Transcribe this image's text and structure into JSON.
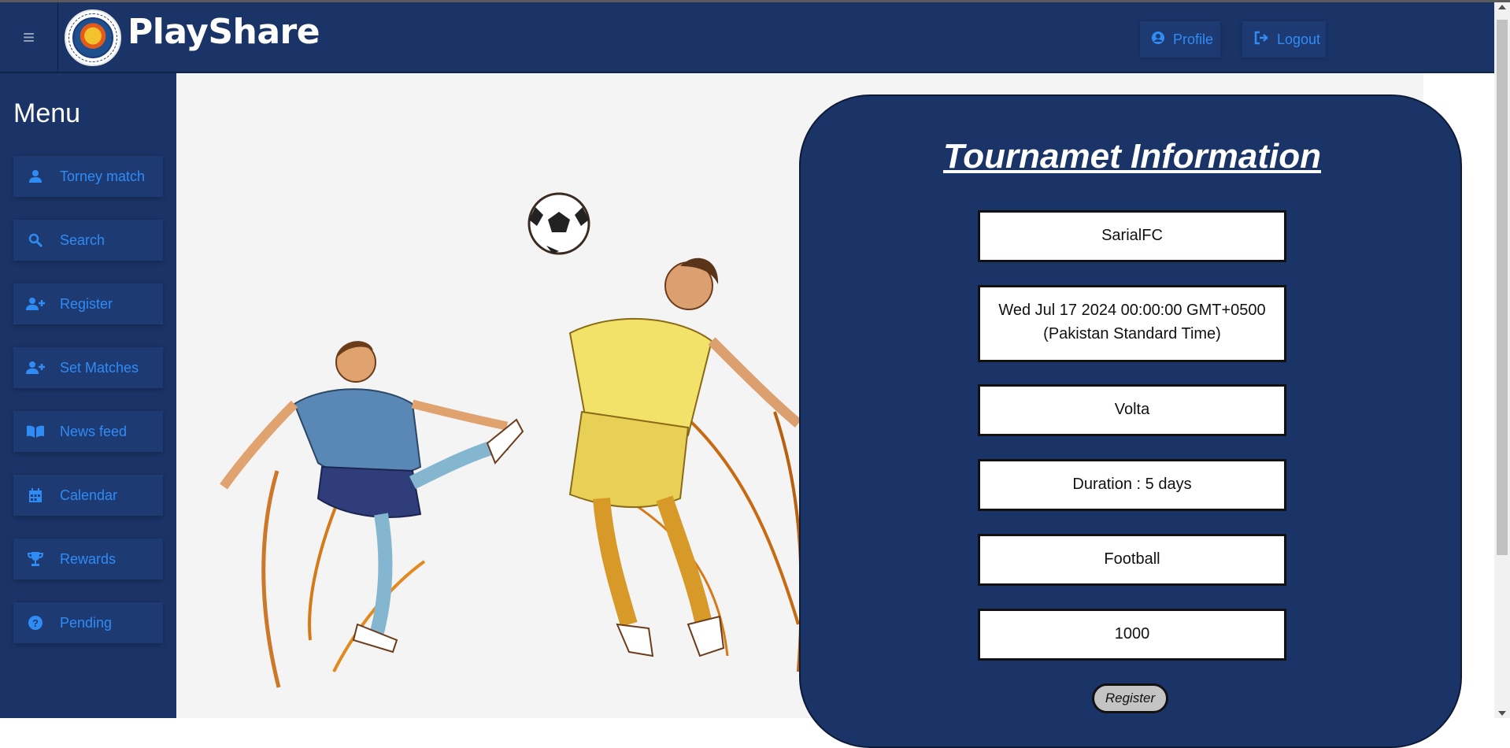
{
  "header": {
    "brand": "PlayShare",
    "profile_label": "Profile",
    "logout_label": "Logout"
  },
  "sidebar": {
    "title": "Menu",
    "items": [
      {
        "label": "Torney match",
        "icon": "user-icon"
      },
      {
        "label": "Search",
        "icon": "search-icon"
      },
      {
        "label": "Register",
        "icon": "user-plus-icon"
      },
      {
        "label": "Set Matches",
        "icon": "user-plus-icon"
      },
      {
        "label": "News feed",
        "icon": "book-open-icon"
      },
      {
        "label": "Calendar",
        "icon": "calendar-icon"
      },
      {
        "label": "Rewards",
        "icon": "trophy-icon"
      },
      {
        "label": "Pending",
        "icon": "question-circle-icon"
      }
    ]
  },
  "card": {
    "title": "Tournamet Information",
    "fields": [
      "SarialFC",
      "Wed Jul 17 2024 00:00:00 GMT+0500 (Pakistan Standard Time)",
      "Volta",
      "Duration : 5 days",
      "Football",
      "1000"
    ],
    "register_label": "Register"
  },
  "colors": {
    "navy": "#1b3468",
    "accent_blue": "#2f8cf5",
    "main_bg": "#f4f4f4"
  }
}
